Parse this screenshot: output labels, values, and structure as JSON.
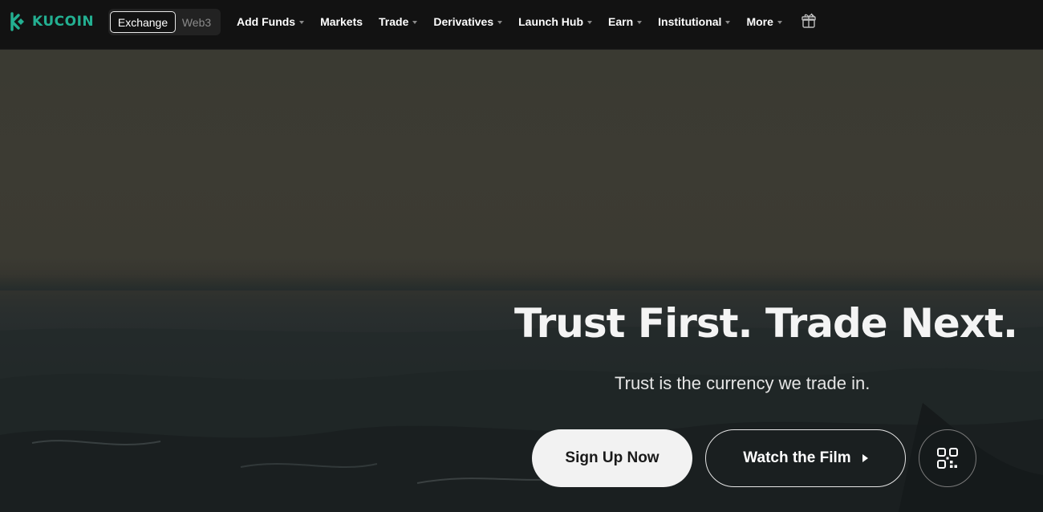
{
  "brand": {
    "name": "KUCOIN",
    "color": "#23af91"
  },
  "switcher": {
    "active": "Exchange",
    "inactive": "Web3"
  },
  "menu": [
    {
      "label": "Add Funds",
      "dropdown": true
    },
    {
      "label": "Markets",
      "dropdown": false
    },
    {
      "label": "Trade",
      "dropdown": true
    },
    {
      "label": "Derivatives",
      "dropdown": true
    },
    {
      "label": "Launch Hub",
      "dropdown": true
    },
    {
      "label": "Earn",
      "dropdown": true
    },
    {
      "label": "Institutional",
      "dropdown": true
    },
    {
      "label": "More",
      "dropdown": true
    }
  ],
  "icons": {
    "gift": "gift-icon",
    "qr": "qr-code-icon",
    "logo": "kucoin-logo-icon",
    "play": "play-icon"
  },
  "hero": {
    "headline": "Trust First. Trade Next.",
    "subline": "Trust is the currency we trade in.",
    "signup_label": "Sign Up Now",
    "film_label": "Watch the Film"
  }
}
